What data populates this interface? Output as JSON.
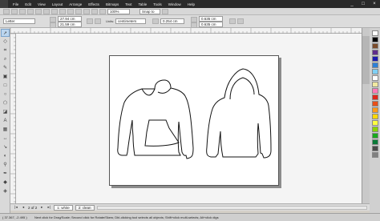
{
  "menu": {
    "items": [
      "File",
      "Edit",
      "View",
      "Layout",
      "Arrange",
      "Effects",
      "Bitmaps",
      "Text",
      "Table",
      "Tools",
      "Window",
      "Help"
    ],
    "window_controls": [
      "_",
      "□",
      "×"
    ]
  },
  "toolbar": {
    "zoom": "100%",
    "snap": "Snap to"
  },
  "propbar": {
    "page_size": "Letter",
    "width": "27.94 cm",
    "height": "21.59 cm",
    "units_label": "Units:",
    "units": "centimeters",
    "nudge": "0.254 cm",
    "dup_x": "0.635 cm",
    "dup_y": "0.635 cm"
  },
  "pages": {
    "counter": "2 of 2",
    "tabs": [
      "1: white",
      "2: clean"
    ]
  },
  "status": {
    "coords": "( 37.367, -2.495 )",
    "hint": "Next click for Drag/Scale; Second click for Rotate/Skew; Dbl-clicking tool selects all objects; Shift+click multi-selects; Alt+click digs"
  },
  "palette": {
    "colors": [
      "#ffffff",
      "#000000",
      "#7a4b2a",
      "#5f2d8c",
      "#1b1bb0",
      "#2d7fd6",
      "#7fd0f5",
      "#ffffff",
      "#f0e8a0",
      "#ff7ab8",
      "#e0261a",
      "#e8501a",
      "#ff9a1a",
      "#ffd800",
      "#ffff40",
      "#8ad400",
      "#19a91e",
      "#0a7a38",
      "#4a4a4a",
      "#808080"
    ]
  }
}
